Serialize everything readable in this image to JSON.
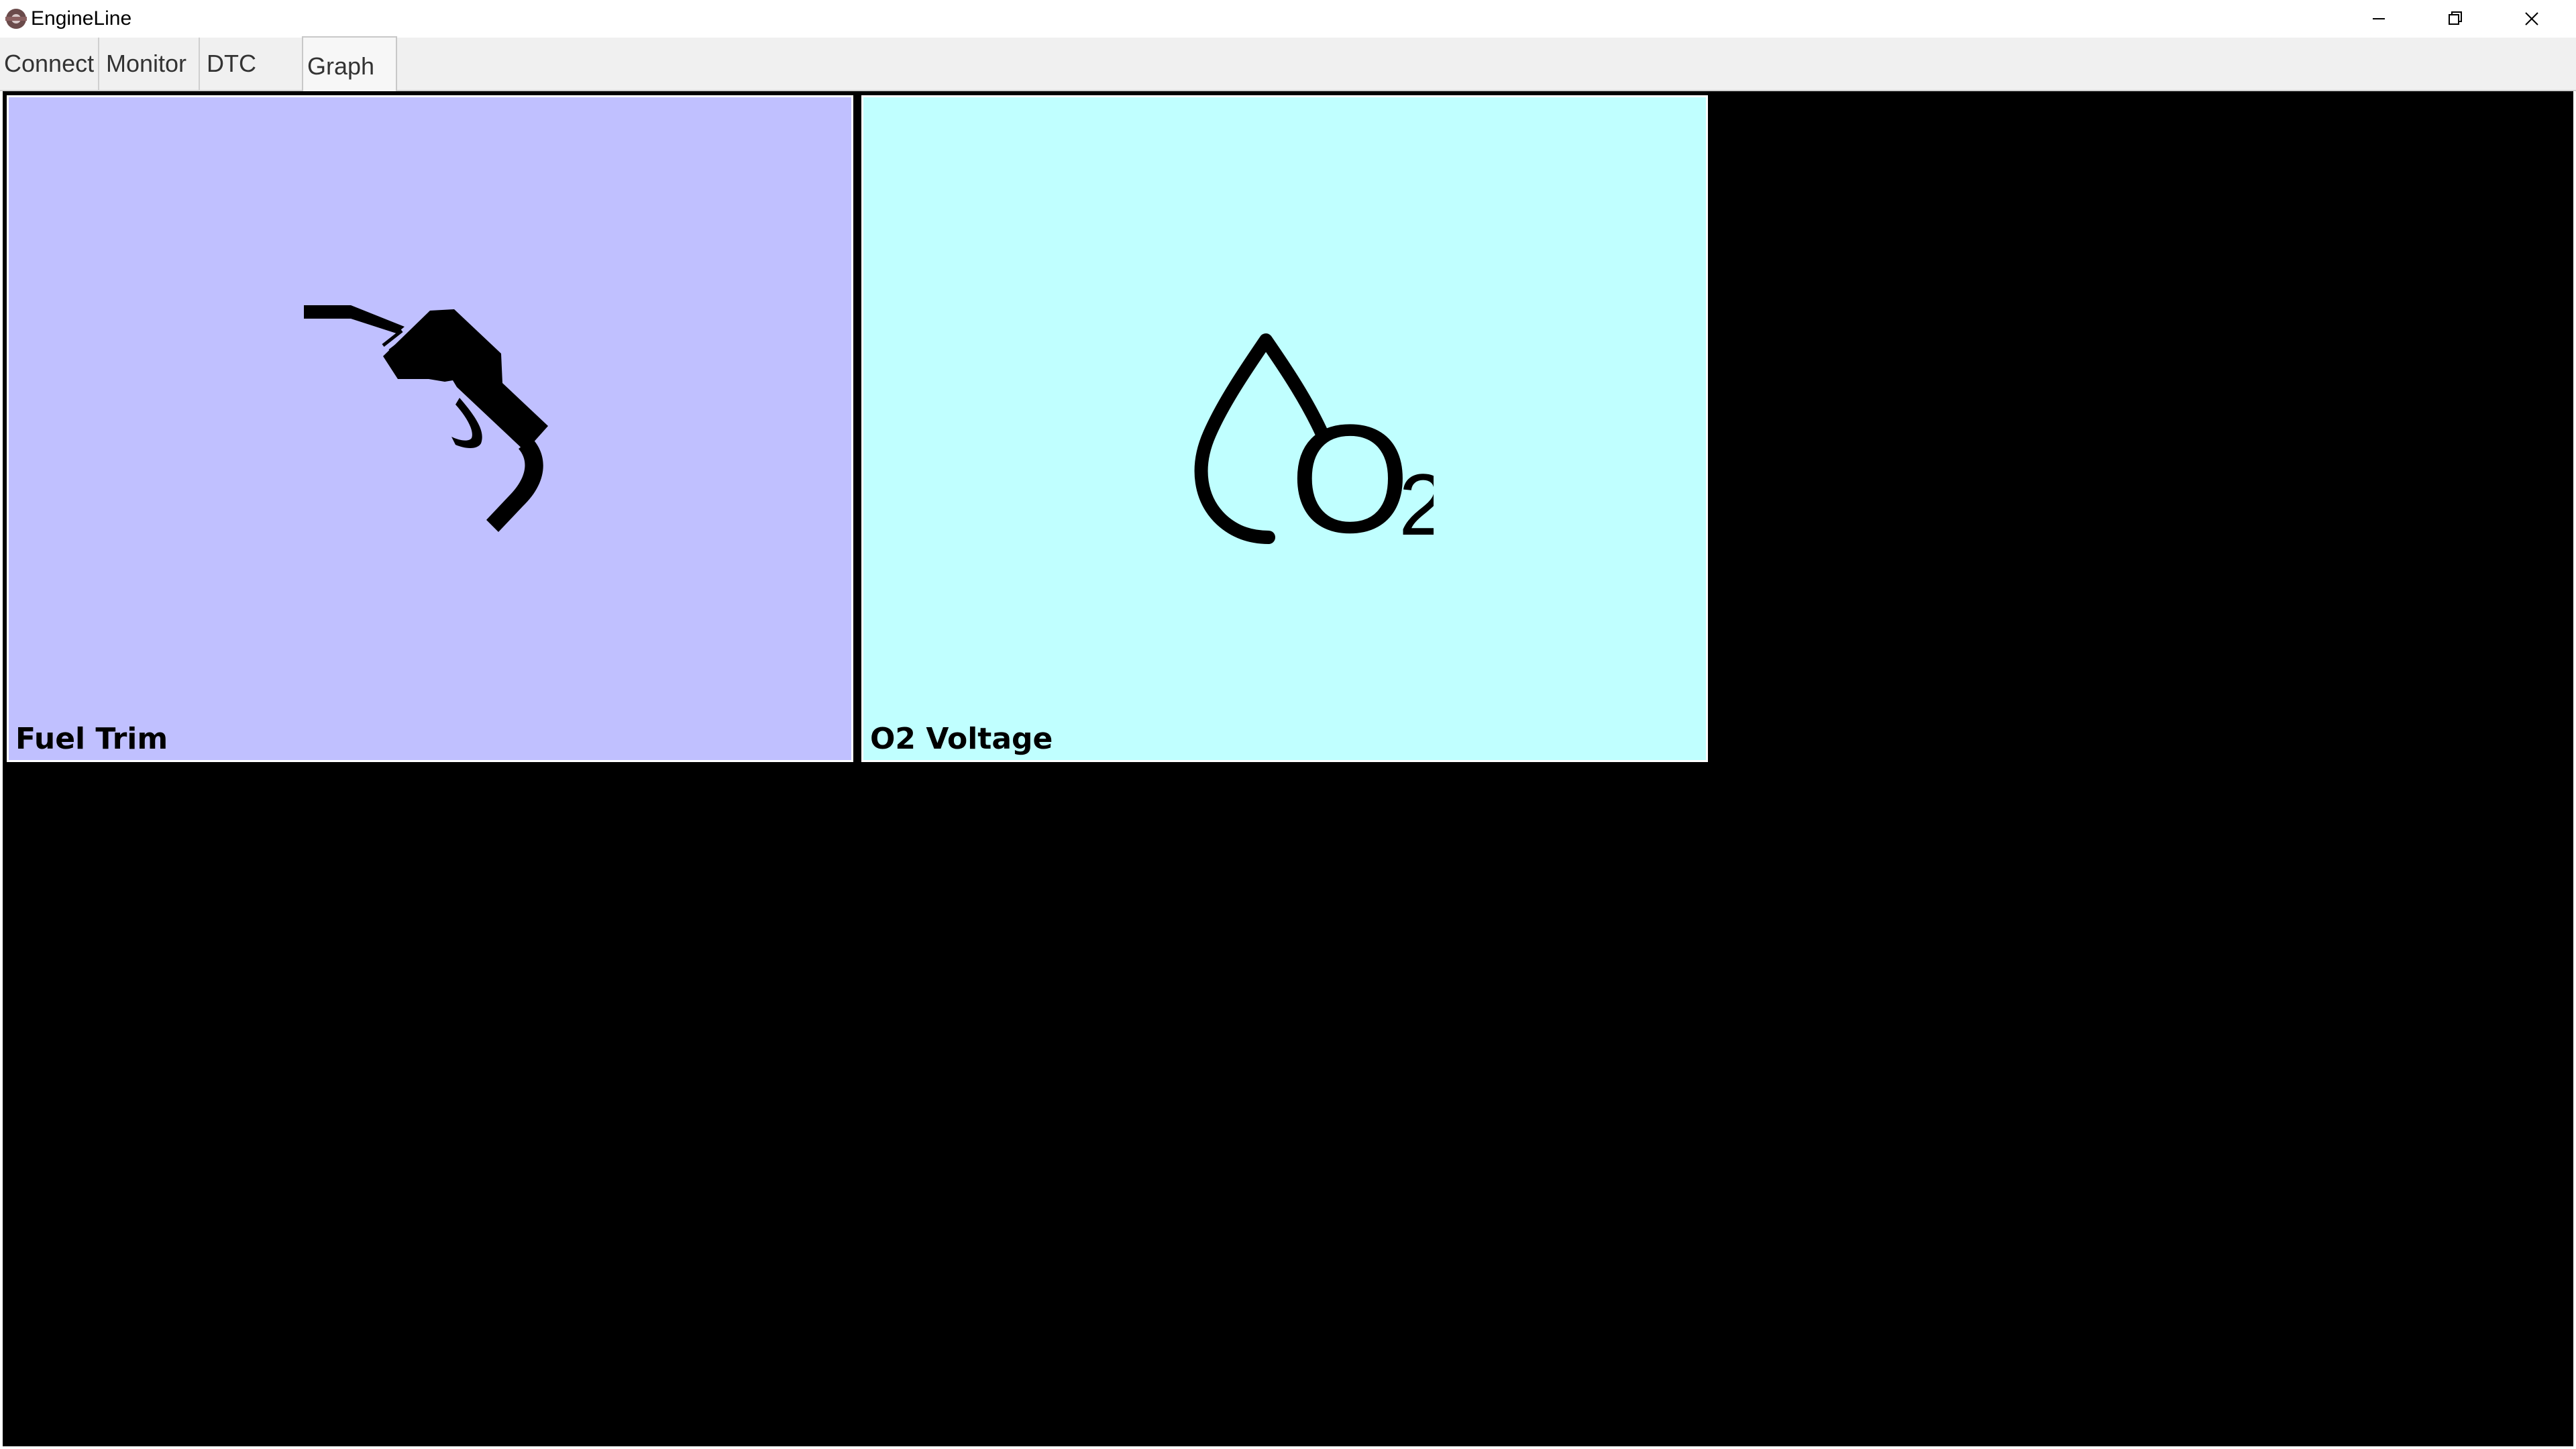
{
  "window": {
    "title": "EngineLine",
    "minimize_icon": "minimize-icon",
    "restore_icon": "restore-icon",
    "close_icon": "close-icon"
  },
  "tabs": [
    {
      "label": "Connect",
      "active": false
    },
    {
      "label": "Monitor",
      "active": false
    },
    {
      "label": "DTC",
      "active": false
    },
    {
      "label": "Graph",
      "active": true
    }
  ],
  "tiles": [
    {
      "label": "Fuel Trim",
      "color": "#c0c0ff",
      "icon": "fuel-nozzle-icon"
    },
    {
      "label": "O2 Voltage",
      "color": "#c0ffff",
      "icon": "oxygen-drop-icon",
      "icon_text": "O",
      "icon_subscript": "2"
    }
  ],
  "colors": {
    "canvas_background": "#000000",
    "tabbar_background": "#f0f0f0"
  }
}
